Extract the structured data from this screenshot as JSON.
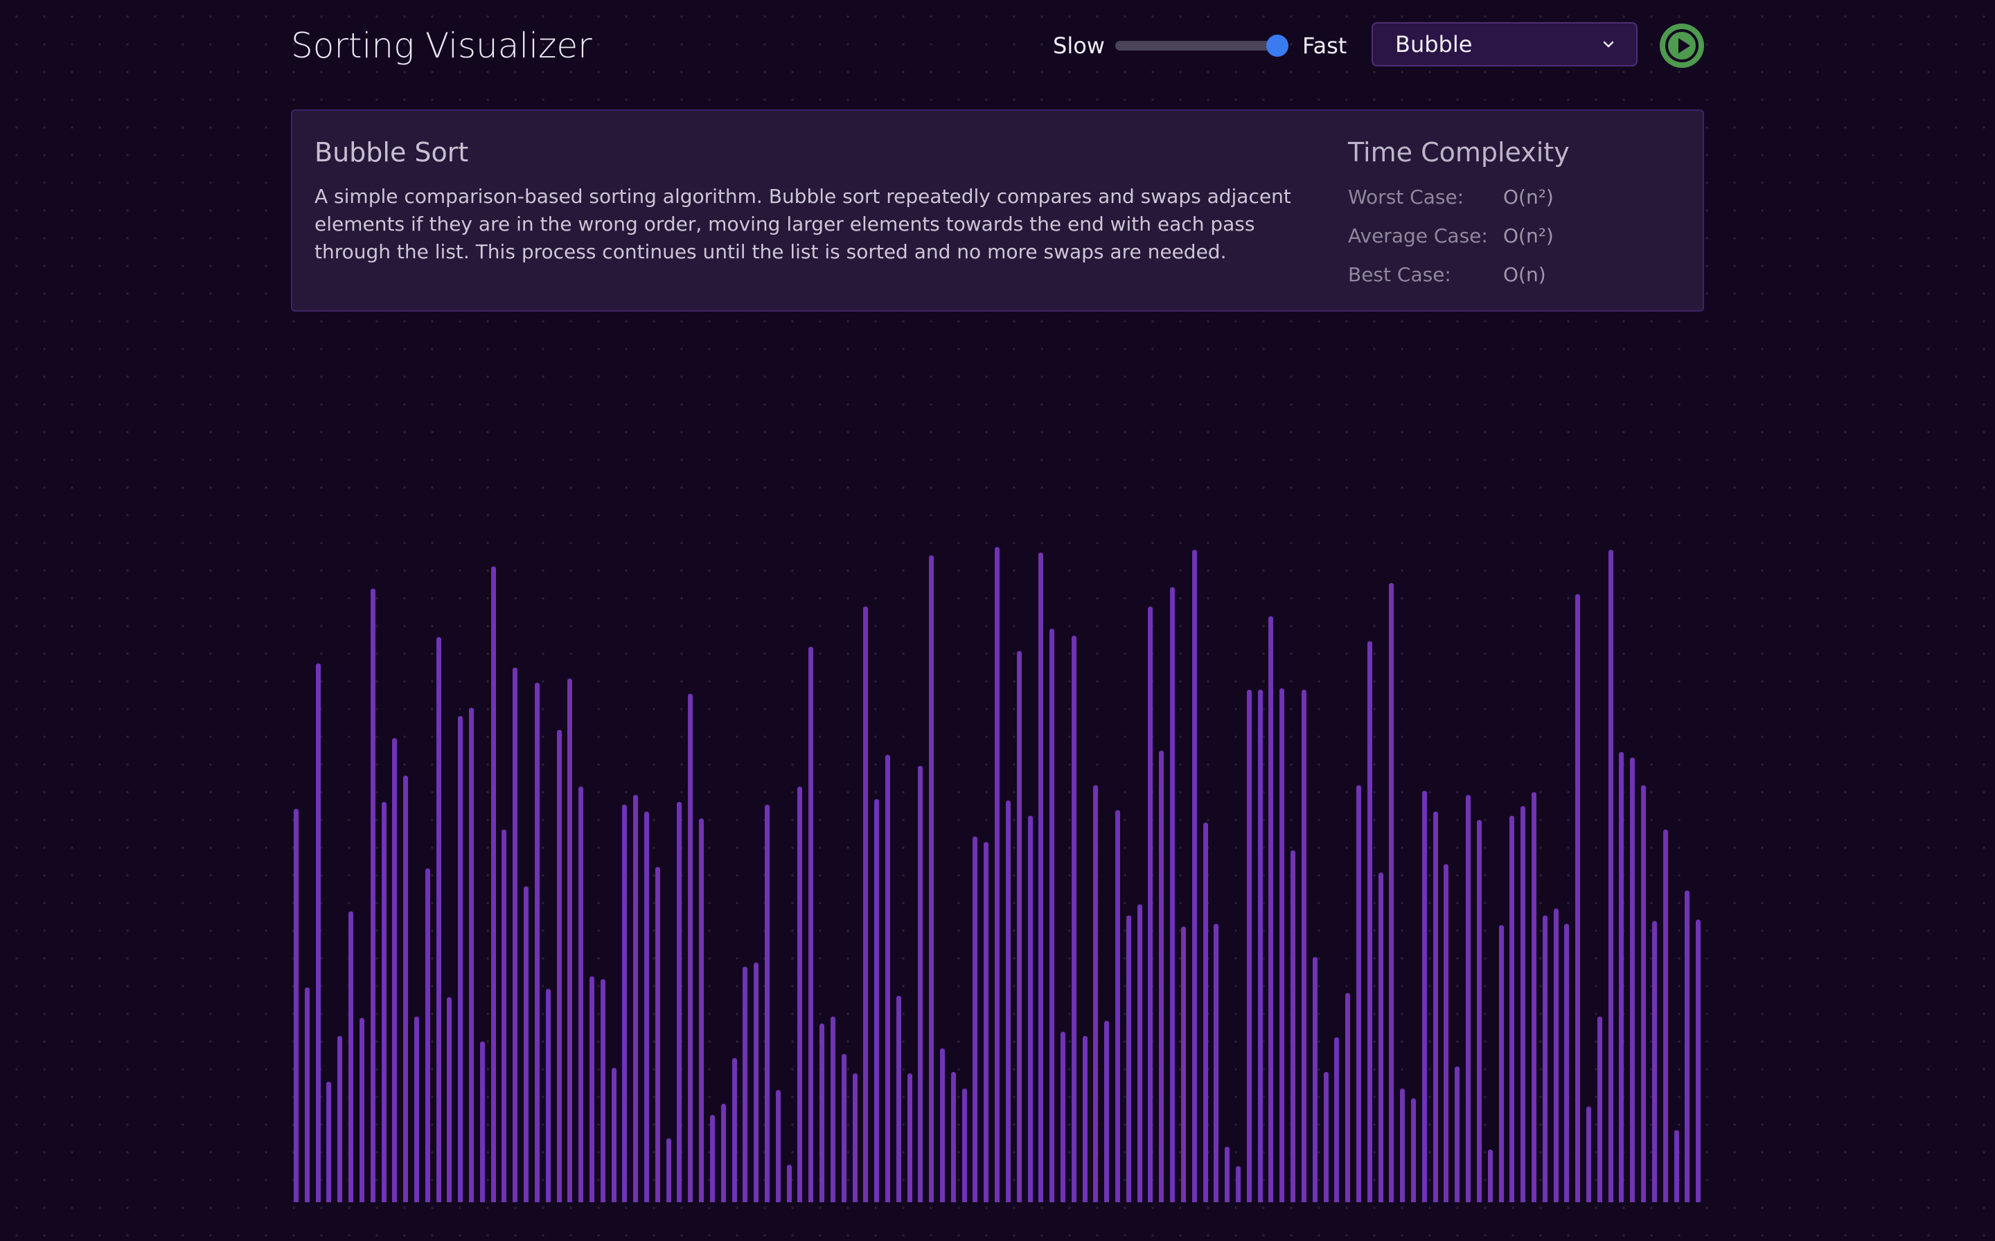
{
  "header": {
    "title": "Sorting Visualizer",
    "speed_slow_label": "Slow",
    "speed_fast_label": "Fast",
    "speed_value": 1.0,
    "algorithm_selected": "Bubble",
    "play_icon": "play-icon"
  },
  "info": {
    "algorithm_name": "Bubble Sort",
    "description": "A simple comparison-based sorting algorithm. Bubble sort repeatedly compares and swaps adjacent elements if they are in the wrong order, moving larger elements towards the end with each pass through the list. This process continues until the list is sorted and no more swaps are needed.",
    "complexity_title": "Time Complexity",
    "complexity": [
      {
        "label": "Worst Case:",
        "value": "O(n²)"
      },
      {
        "label": "Average Case:",
        "value": "O(n²)"
      },
      {
        "label": "Best Case:",
        "value": "O(n)"
      }
    ]
  },
  "colors": {
    "bar": "#7034b4",
    "accent": "#3b7bf0",
    "play": "#4e9a4e",
    "background": "#12071f"
  },
  "array_values": [
    568,
    310,
    778,
    174,
    240,
    420,
    266,
    886,
    578,
    670,
    616,
    268,
    482,
    816,
    296,
    702,
    714,
    232,
    918,
    538,
    772,
    456,
    750,
    308,
    682,
    756,
    600,
    326,
    322,
    194,
    574,
    588,
    564,
    484,
    92,
    578,
    734,
    554,
    126,
    142,
    208,
    340,
    346,
    574,
    162,
    54,
    600,
    802,
    258,
    268,
    214,
    186,
    860,
    582,
    646,
    298,
    186,
    630,
    934,
    222,
    188,
    164,
    528,
    520,
    946,
    580,
    796,
    558,
    938,
    828,
    246,
    818,
    240,
    602,
    262,
    566,
    414,
    430,
    860,
    652,
    888,
    398,
    942,
    548,
    402,
    80,
    52,
    740,
    740,
    846,
    742,
    508,
    740,
    354,
    188,
    238,
    302,
    602,
    810,
    476,
    894,
    164,
    150,
    594,
    564,
    488,
    196,
    588,
    552,
    76,
    400,
    558,
    572,
    592,
    414,
    424,
    402,
    878,
    138,
    268,
    942,
    650,
    642,
    602,
    406,
    538,
    104,
    450,
    408
  ],
  "value_max": 966
}
